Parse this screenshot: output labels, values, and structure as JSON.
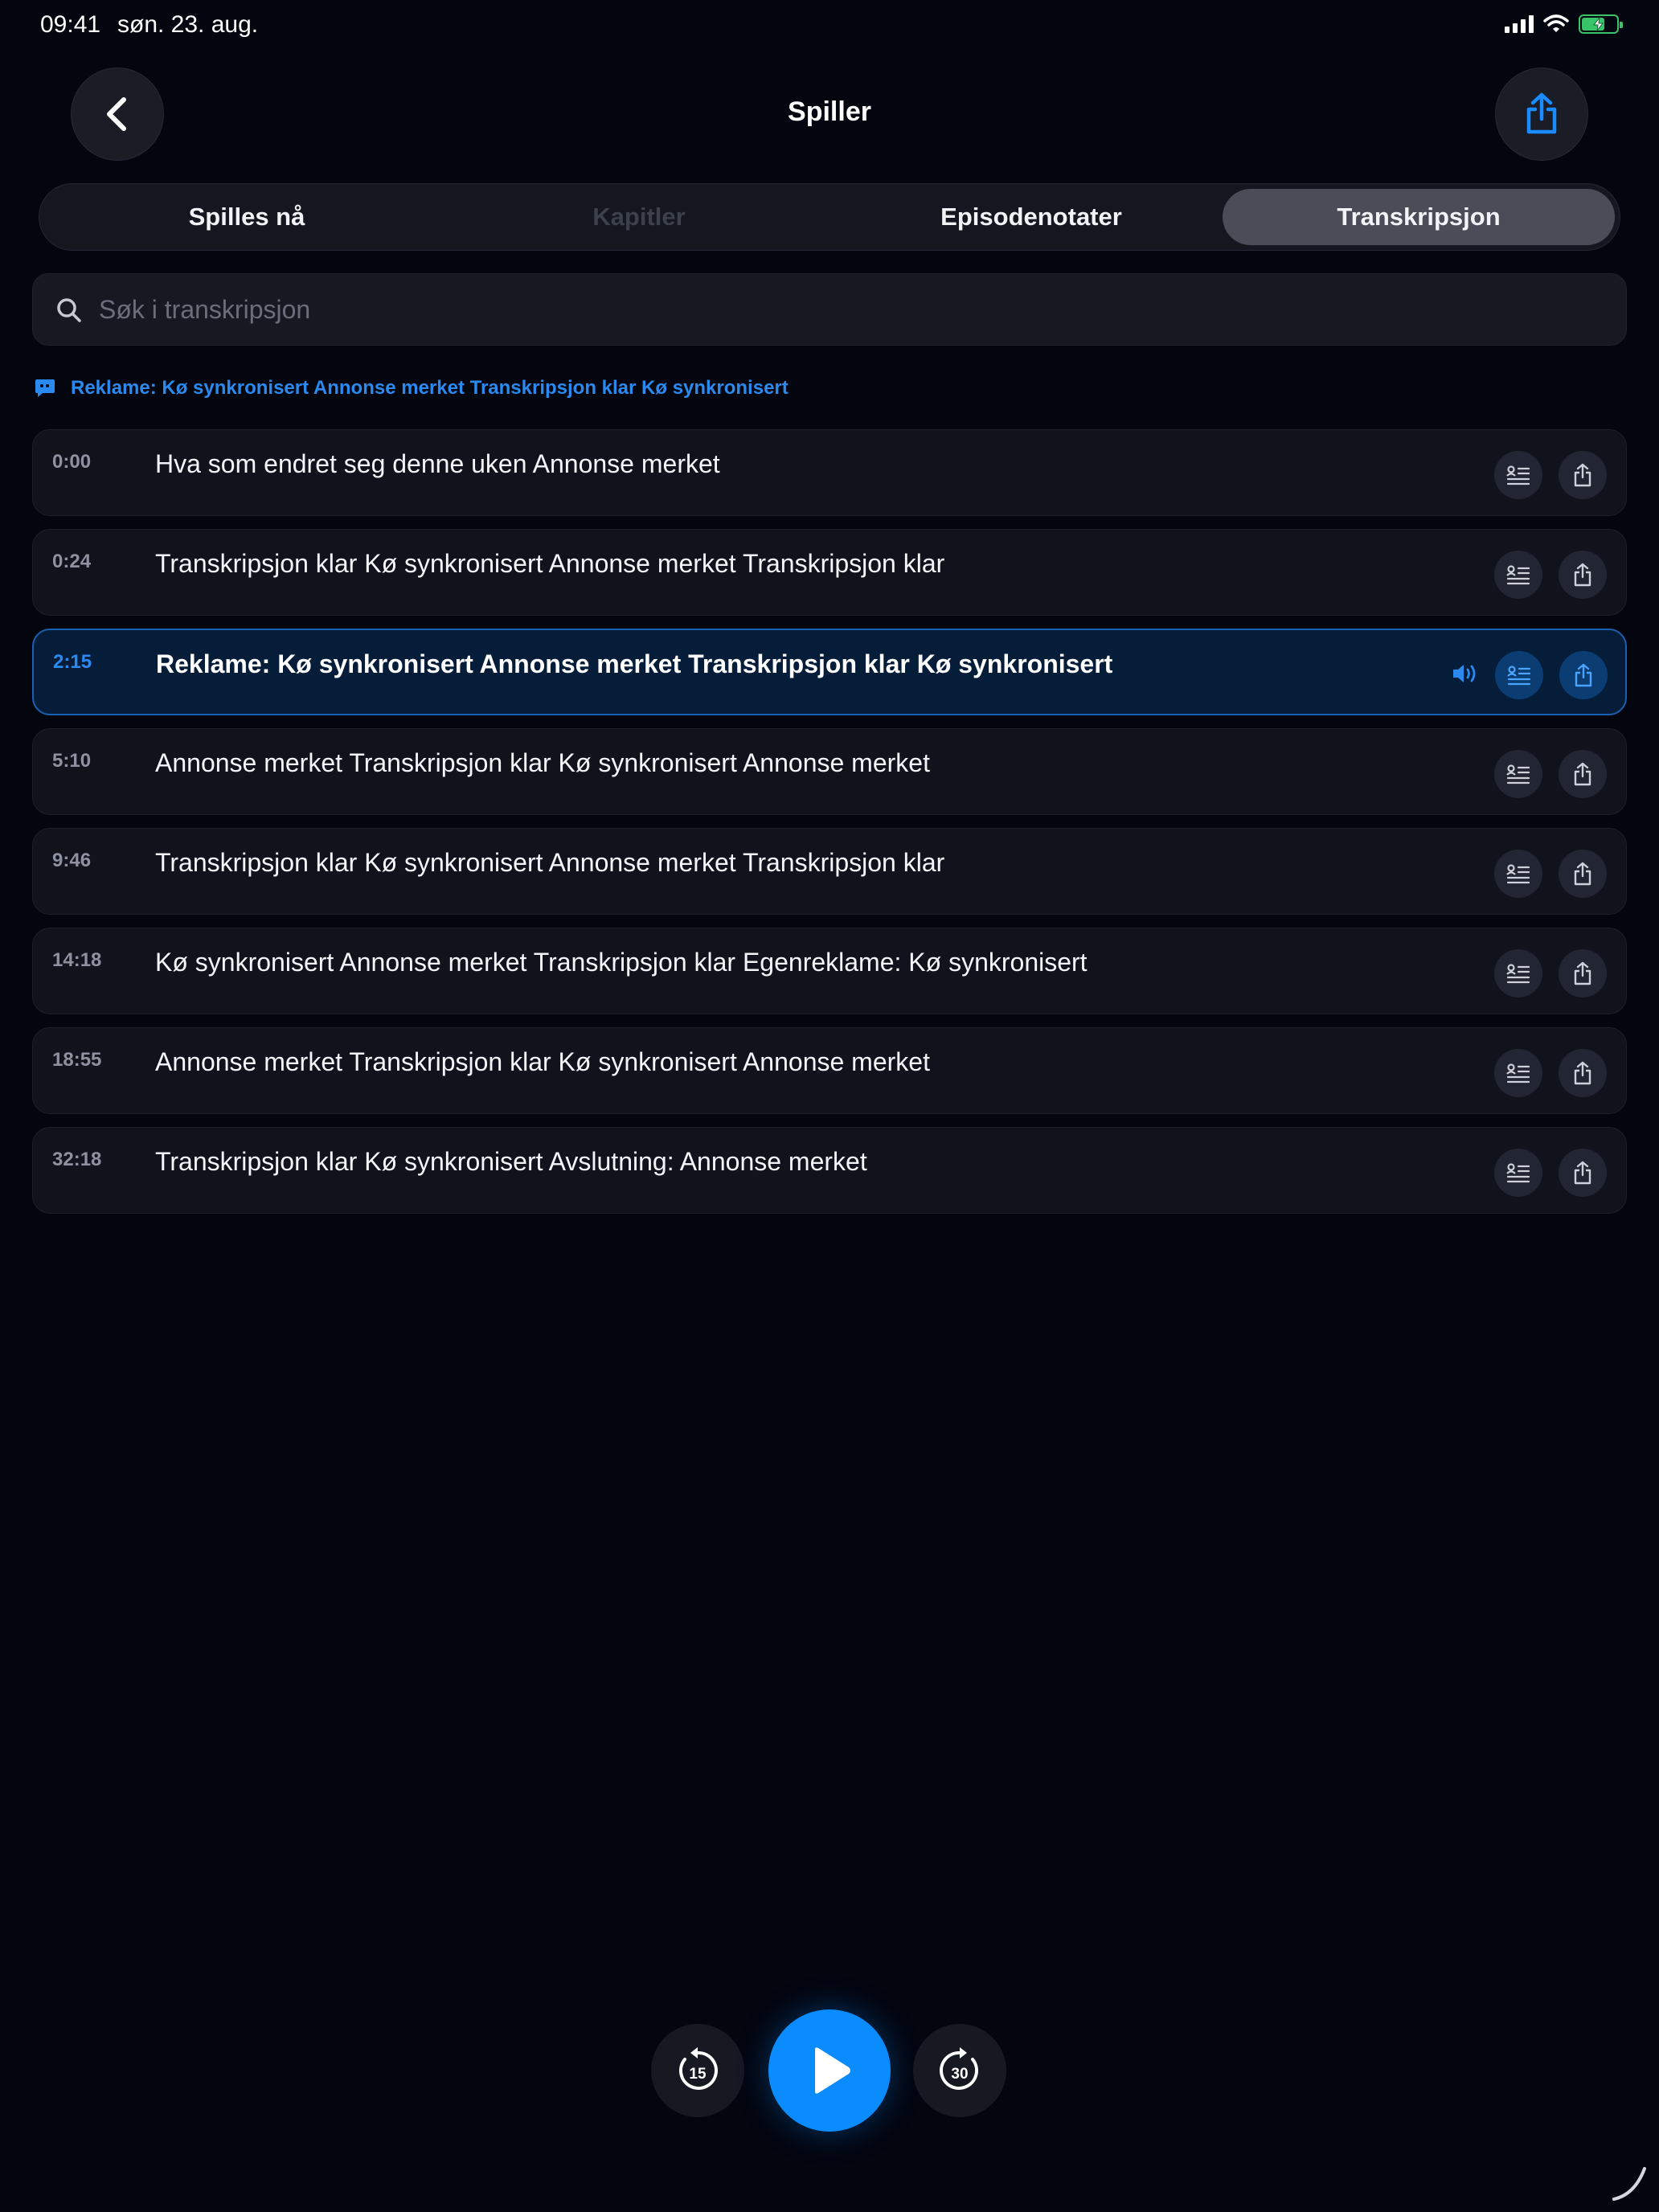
{
  "status_bar": {
    "time": "09:41",
    "date": "søn. 23. aug."
  },
  "header": {
    "title": "Spiller"
  },
  "tabs": [
    {
      "label": "Spilles nå",
      "state": "normal"
    },
    {
      "label": "Kapitler",
      "state": "disabled"
    },
    {
      "label": "Episodenotater",
      "state": "normal"
    },
    {
      "label": "Transkripsjon",
      "state": "selected"
    }
  ],
  "search": {
    "placeholder": "Søk i transkripsjon",
    "value": ""
  },
  "now_playing_banner": {
    "text": "Reklame: Kø synkronisert Annonse merket Transkripsjon klar Kø synkronisert",
    "icon": "speech-bubble-icon"
  },
  "transcript": [
    {
      "time": "0:00",
      "text": "Hva som endret seg denne uken Annonse merket",
      "active": false
    },
    {
      "time": "0:24",
      "text": "Transkripsjon klar Kø synkronisert Annonse merket Transkripsjon klar",
      "active": false
    },
    {
      "time": "2:15",
      "text": "Reklame: Kø synkronisert Annonse merket Transkripsjon klar Kø synkronisert",
      "active": true
    },
    {
      "time": "5:10",
      "text": "Annonse merket Transkripsjon klar Kø synkronisert Annonse merket",
      "active": false
    },
    {
      "time": "9:46",
      "text": "Transkripsjon klar Kø synkronisert Annonse merket Transkripsjon klar",
      "active": false
    },
    {
      "time": "14:18",
      "text": "Kø synkronisert Annonse merket Transkripsjon klar Egenreklame: Kø synkronisert",
      "active": false
    },
    {
      "time": "18:55",
      "text": "Annonse merket Transkripsjon klar Kø synkronisert Annonse merket",
      "active": false
    },
    {
      "time": "32:18",
      "text": "Transkripsjon klar Kø synkronisert Avslutning: Annonse merket",
      "active": false
    }
  ],
  "player": {
    "skip_back_seconds": "15",
    "skip_forward_seconds": "30"
  },
  "colors": {
    "accent": "#0a8cff",
    "banner_text": "#2a8af0",
    "background": "#03050f",
    "active_row": "#061d3a",
    "battery": "#39c46a"
  }
}
